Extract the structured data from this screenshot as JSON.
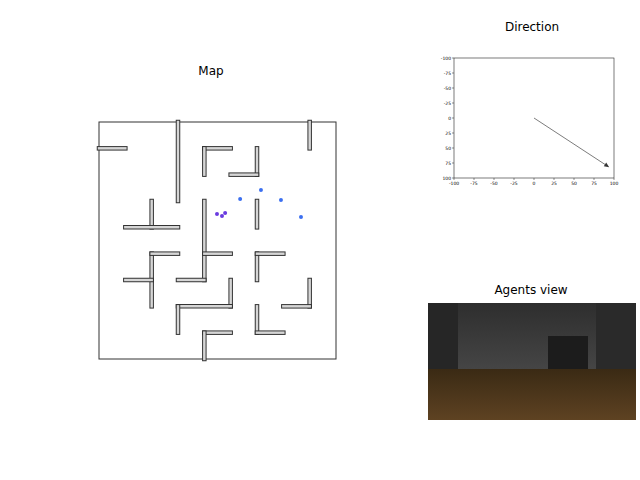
{
  "map": {
    "title": "Map",
    "size": 9,
    "walls": [
      [
        0,
        1,
        1,
        1
      ],
      [
        3,
        0,
        3,
        3
      ],
      [
        8,
        0,
        8,
        1
      ],
      [
        4,
        1,
        5,
        1
      ],
      [
        4,
        1,
        4,
        2
      ],
      [
        6,
        1,
        6,
        2
      ],
      [
        5,
        2,
        6,
        2
      ],
      [
        6,
        3,
        6,
        4
      ],
      [
        2,
        3,
        2,
        4
      ],
      [
        1,
        4,
        3,
        4
      ],
      [
        4,
        3,
        4,
        6
      ],
      [
        4,
        5,
        5,
        5
      ],
      [
        2,
        5,
        2,
        7
      ],
      [
        2,
        5,
        3,
        5
      ],
      [
        1,
        6,
        2,
        6
      ],
      [
        3,
        6,
        4,
        6
      ],
      [
        6,
        5,
        6,
        6
      ],
      [
        6,
        5,
        7,
        5
      ],
      [
        5,
        6,
        5,
        7
      ],
      [
        3,
        7,
        5,
        7
      ],
      [
        8,
        6,
        8,
        7
      ],
      [
        7,
        7,
        8,
        7
      ],
      [
        3,
        7,
        3,
        8
      ],
      [
        6,
        7,
        6,
        8
      ],
      [
        6,
        8,
        7,
        8
      ],
      [
        4,
        8,
        5,
        8
      ],
      [
        4,
        8,
        4,
        9
      ]
    ],
    "agents": [
      {
        "x": 4.48,
        "y": 3.49,
        "color": "#6a3ce0"
      },
      {
        "x": 4.67,
        "y": 3.57,
        "color": "#6a3ce0"
      },
      {
        "x": 4.79,
        "y": 3.46,
        "color": "#6a3ce0"
      },
      {
        "x": 5.36,
        "y": 2.92,
        "color": "#3b6ff0"
      },
      {
        "x": 6.15,
        "y": 2.58,
        "color": "#3b6ff0"
      },
      {
        "x": 6.91,
        "y": 2.96,
        "color": "#3b6ff0"
      },
      {
        "x": 7.67,
        "y": 3.61,
        "color": "#3b6ff0"
      }
    ]
  },
  "direction": {
    "title": "Direction",
    "x_ticks": [
      "-100",
      "-75",
      "-50",
      "-25",
      "0",
      "25",
      "50",
      "75",
      "100"
    ],
    "y_ticks": [
      "-100",
      "-75",
      "-50",
      "-25",
      "0",
      "25",
      "50",
      "75",
      "100"
    ],
    "arrow": {
      "dx": 94,
      "dy": 82
    }
  },
  "agents_view": {
    "title": "Agents view"
  }
}
